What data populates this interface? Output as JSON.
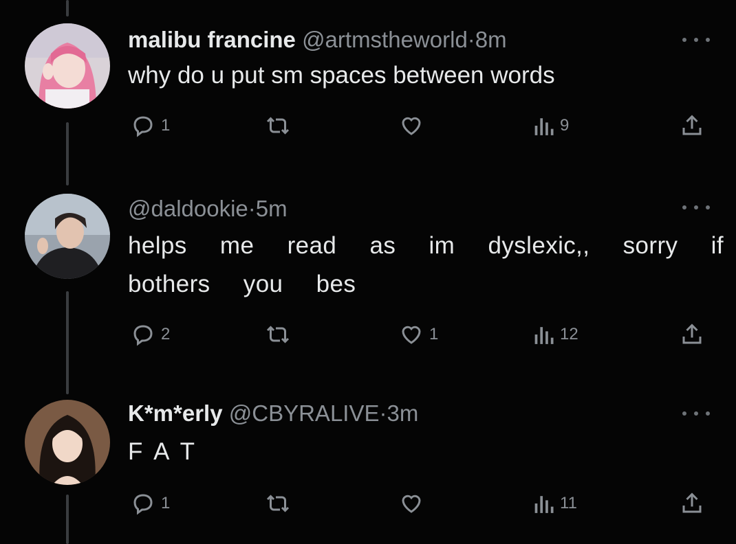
{
  "tweets": [
    {
      "name": "malibu francine",
      "handle": "@artmstheworld",
      "separator": "·",
      "time": "8m",
      "text_lines": [
        "why do u put sm spaces between words"
      ],
      "replies": "1",
      "retweets": "",
      "likes": "",
      "views": "9"
    },
    {
      "name": "",
      "handle": "@daldookie",
      "separator": "·",
      "time": "5m",
      "text_lines": [
        "helps  me  read  as  im  dyslexic,,  sorry  if  it",
        "bothers  you  bes"
      ],
      "replies": "2",
      "retweets": "",
      "likes": "1",
      "views": "12"
    },
    {
      "name": "K*m*erly",
      "handle": "@CBYRALIVE",
      "separator": "·",
      "time": "3m",
      "text_lines": [
        "F A T"
      ],
      "replies": "1",
      "retweets": "",
      "likes": "",
      "views": "11"
    }
  ],
  "icons": {
    "reply": "reply-icon",
    "retweet": "retweet-icon",
    "like": "heart-icon",
    "views": "views-chart-icon",
    "share": "share-icon",
    "more": "more-dots-icon"
  },
  "colors": {
    "background": "#050505",
    "text": "#e7e9ea",
    "muted": "#8b9096",
    "thread_line": "#3a3d40"
  }
}
